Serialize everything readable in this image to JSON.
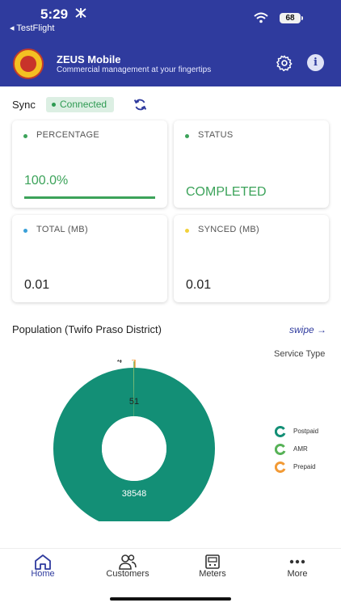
{
  "status_bar": {
    "time": "5:29",
    "back_label": "◂ TestFlight",
    "battery": "68"
  },
  "header": {
    "title": "ZEUS Mobile",
    "subtitle": "Commercial management at your fingertips",
    "background": "#2f3b9e"
  },
  "sync": {
    "label": "Sync",
    "status": "Connected"
  },
  "cards": {
    "percentage": {
      "label": "PERCENTAGE",
      "value": "100.0%",
      "progress": 100,
      "color": "#3ca35a"
    },
    "status": {
      "label": "STATUS",
      "value": "COMPLETED",
      "color": "#3ca35a"
    },
    "total": {
      "label": "TOTAL (MB)",
      "value": "0.01",
      "dot_color": "#3aa0d8"
    },
    "synced": {
      "label": "SYNCED (MB)",
      "value": "0.01",
      "dot_color": "#f2d13a"
    }
  },
  "population": {
    "title": "Population (Twifo Praso District)",
    "swipe_label": "swipe →"
  },
  "chart_data": {
    "type": "pie",
    "subtitle": "Service Type",
    "categories": [
      "Postpaid",
      "AMR",
      "Prepaid"
    ],
    "values": [
      38548,
      51,
      4
    ],
    "colors": [
      "#138f76",
      "#57b257",
      "#f29a35"
    ],
    "data_labels": [
      "38548",
      "51",
      "4"
    ],
    "legend_position": "right"
  },
  "tabbar": {
    "items": [
      {
        "label": "Home",
        "icon": "home-icon",
        "active": true
      },
      {
        "label": "Customers",
        "icon": "users-icon",
        "active": false
      },
      {
        "label": "Meters",
        "icon": "meter-icon",
        "active": false
      },
      {
        "label": "More",
        "icon": "more-icon",
        "active": false
      }
    ],
    "active_color": "#2f3b9e"
  }
}
